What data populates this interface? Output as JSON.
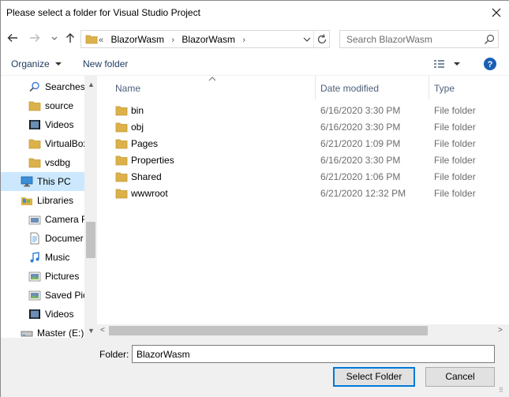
{
  "window": {
    "title": "Please select a folder for Visual Studio Project"
  },
  "address": {
    "overflow": "«",
    "crumbs": [
      "BlazorWasm",
      "BlazorWasm"
    ],
    "separator": "›"
  },
  "search": {
    "placeholder": "Search BlazorWasm"
  },
  "toolbar": {
    "organize_label": "Organize",
    "new_folder_label": "New folder"
  },
  "nav": {
    "items": [
      {
        "label": "Searches",
        "icon": "search-icon"
      },
      {
        "label": "source",
        "icon": "folder-icon"
      },
      {
        "label": "Videos",
        "icon": "video-icon"
      },
      {
        "label": "VirtualBox",
        "icon": "folder-icon"
      },
      {
        "label": "vsdbg",
        "icon": "folder-icon"
      },
      {
        "label": "This PC",
        "icon": "computer-icon"
      },
      {
        "label": "Libraries",
        "icon": "libraries-icon"
      },
      {
        "label": "Camera R",
        "icon": "camera-roll-icon"
      },
      {
        "label": "Documer",
        "icon": "documents-icon"
      },
      {
        "label": "Music",
        "icon": "music-icon"
      },
      {
        "label": "Pictures",
        "icon": "pictures-icon"
      },
      {
        "label": "Saved Pic",
        "icon": "pictures-icon"
      },
      {
        "label": "Videos",
        "icon": "video-icon"
      },
      {
        "label": "Master (E:)",
        "icon": "drive-icon"
      }
    ],
    "selected": "This PC"
  },
  "columns": {
    "name": "Name",
    "date": "Date modified",
    "type": "Type"
  },
  "files": [
    {
      "name": "bin",
      "date": "6/16/2020 3:30 PM",
      "type": "File folder"
    },
    {
      "name": "obj",
      "date": "6/16/2020 3:30 PM",
      "type": "File folder"
    },
    {
      "name": "Pages",
      "date": "6/21/2020 1:09 PM",
      "type": "File folder"
    },
    {
      "name": "Properties",
      "date": "6/16/2020 3:30 PM",
      "type": "File folder"
    },
    {
      "name": "Shared",
      "date": "6/21/2020 1:06 PM",
      "type": "File folder"
    },
    {
      "name": "wwwroot",
      "date": "6/21/2020 12:32 PM",
      "type": "File folder"
    }
  ],
  "footer": {
    "folder_label": "Folder:",
    "folder_value": "BlazorWasm",
    "select_label": "Select Folder",
    "cancel_label": "Cancel"
  },
  "colors": {
    "folder": "#dcb14a",
    "selection": "#cce8ff",
    "accent": "#0078d7"
  }
}
